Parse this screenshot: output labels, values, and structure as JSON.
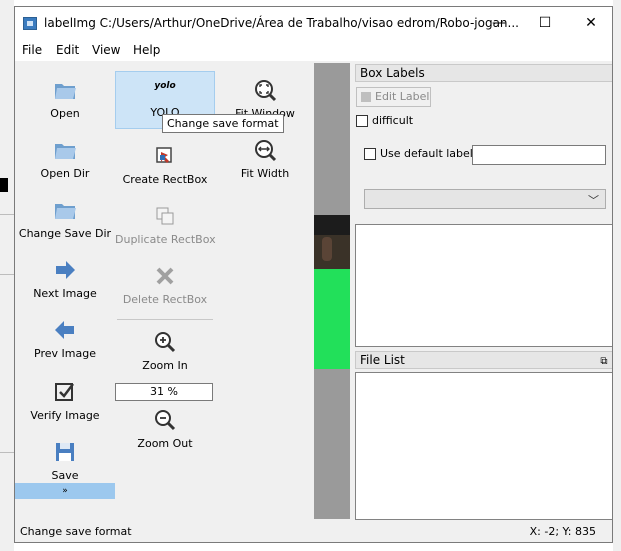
{
  "window": {
    "title": "labelImg C:/Users/Arthur/OneDrive/Área de Trabalho/visao edrom/Robo-jogan...",
    "minimize": "—",
    "maximize": "☐",
    "close": "✕"
  },
  "menu": [
    "File",
    "Edit",
    "View",
    "Help"
  ],
  "toolbar": {
    "open": "Open",
    "open_dir": "Open Dir",
    "change_save_dir": "Change Save Dir",
    "next_image": "Next Image",
    "prev_image": "Prev Image",
    "verify_image": "Verify Image",
    "save": "Save",
    "format_icon_text": "yolo",
    "format": "YOLO",
    "create_rectbox": "Create RectBox",
    "duplicate_rectbox": "Duplicate RectBox",
    "delete_rectbox": "Delete RectBox",
    "zoom_in": "Zoom In",
    "zoom_value": "31 %",
    "zoom_out": "Zoom Out",
    "fit_window": "Fit Window",
    "fit_width": "Fit Width",
    "expand": "»"
  },
  "tooltip": "Change save format",
  "box_labels": {
    "title": "Box Labels",
    "edit_label": "Edit Label",
    "difficult": "difficult",
    "use_default_label": "Use default label",
    "default_label_value": ""
  },
  "file_list": {
    "title": "File List",
    "float_icon": "⧉"
  },
  "status": {
    "message": "Change save format",
    "coords": "X: -2; Y: 835"
  },
  "colors": {
    "accent_blue": "#3a7bbf",
    "selected_bg": "#cde4f7",
    "field_green": "#22e05a"
  }
}
